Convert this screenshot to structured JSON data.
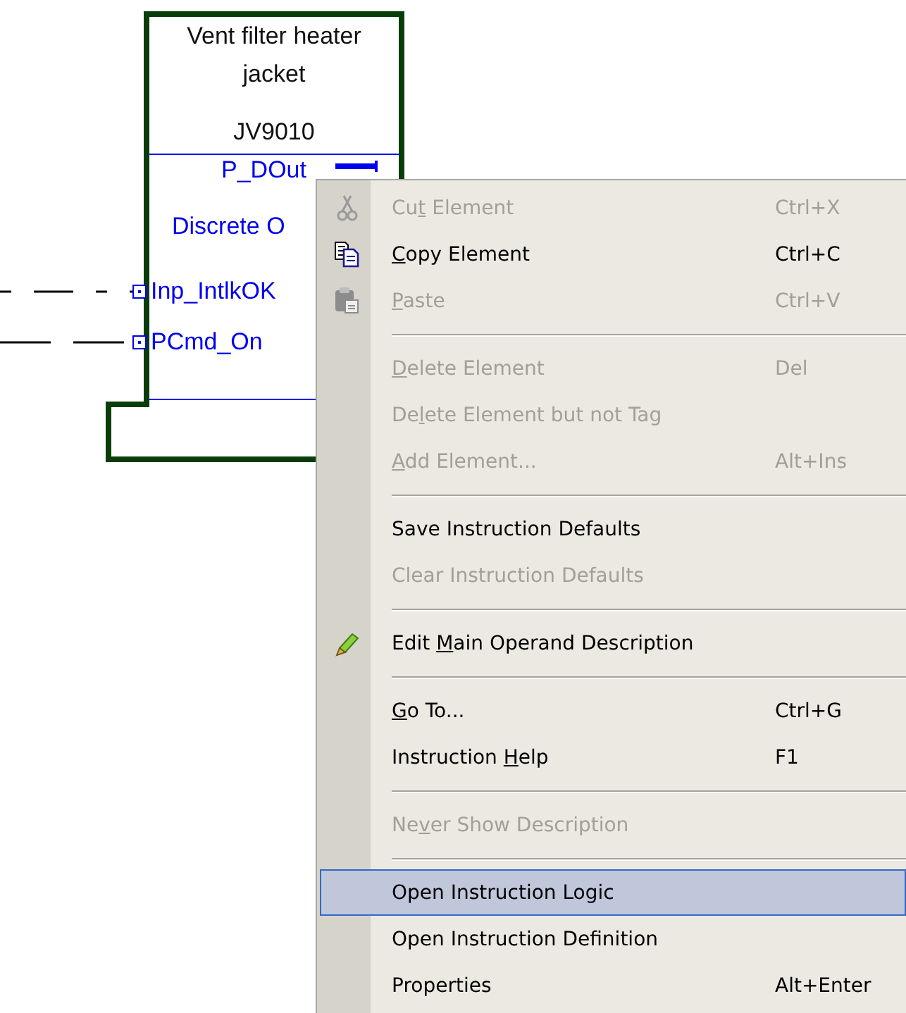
{
  "block": {
    "title": "Vent filter heater jacket",
    "tag": "JV9010",
    "pins": [
      {
        "label": "P_DOut",
        "kind": "output"
      },
      {
        "label": "Discrete O",
        "kind": "description"
      },
      {
        "label": "Inp_IntlkOK",
        "kind": "input"
      },
      {
        "label": "PCmd_On",
        "kind": "input"
      }
    ]
  },
  "context_menu": {
    "items": [
      {
        "kind": "item",
        "label": "Cut Element",
        "shortcut": "Ctrl+X",
        "disabled": true,
        "selected": false
      },
      {
        "kind": "item",
        "label": "Copy Element",
        "shortcut": "Ctrl+C",
        "disabled": false,
        "selected": false
      },
      {
        "kind": "item",
        "label": "Paste",
        "shortcut": "Ctrl+V",
        "disabled": true,
        "selected": false
      },
      {
        "kind": "separator"
      },
      {
        "kind": "item",
        "label": "Delete Element",
        "shortcut": "Del",
        "disabled": true,
        "selected": false
      },
      {
        "kind": "item",
        "label": "Delete Element but not Tag",
        "disabled": true,
        "selected": false
      },
      {
        "kind": "item",
        "label": "Add Element...",
        "shortcut": "Alt+Ins",
        "disabled": true,
        "selected": false
      },
      {
        "kind": "separator"
      },
      {
        "kind": "item",
        "label": "Save Instruction Defaults",
        "disabled": false,
        "selected": false
      },
      {
        "kind": "item",
        "label": "Clear Instruction Defaults",
        "disabled": true,
        "selected": false
      },
      {
        "kind": "separator"
      },
      {
        "kind": "item",
        "label": "Edit Main Operand Description",
        "disabled": false,
        "selected": false
      },
      {
        "kind": "separator"
      },
      {
        "kind": "item",
        "label": "Go To...",
        "shortcut": "Ctrl+G",
        "disabled": false,
        "selected": false
      },
      {
        "kind": "item",
        "label": "Instruction Help",
        "shortcut": "F1",
        "disabled": false,
        "selected": false
      },
      {
        "kind": "separator"
      },
      {
        "kind": "item",
        "label": "Never Show Description",
        "disabled": true,
        "selected": false
      },
      {
        "kind": "separator"
      },
      {
        "kind": "item",
        "label": "Open Instruction Logic",
        "disabled": false,
        "selected": true
      },
      {
        "kind": "item",
        "label": "Open Instruction Definition",
        "disabled": false,
        "selected": false
      },
      {
        "kind": "item",
        "label": "Properties",
        "shortcut": "Alt+Enter",
        "disabled": false,
        "selected": false
      }
    ]
  }
}
